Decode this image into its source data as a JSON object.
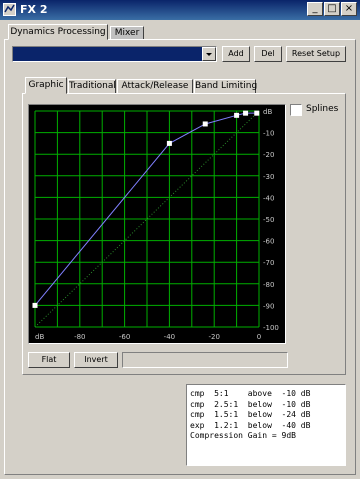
{
  "window": {
    "title": "FX 2",
    "btn_min": "_",
    "btn_max": "□",
    "btn_close": "×"
  },
  "main_tabs": [
    "Dynamics Processing",
    "Mixer"
  ],
  "toolbar": {
    "preset_value": "",
    "add": "Add",
    "del": "Del",
    "reset": "Reset Setup"
  },
  "sub_tabs": [
    "Graphic",
    "Traditional",
    "Attack/Release",
    "Band Limiting"
  ],
  "splines": {
    "label": "Splines",
    "checked": false
  },
  "graph": {
    "y_ticks": [
      "dB",
      "-10",
      "-20",
      "-30",
      "-40",
      "-50",
      "-60",
      "-70",
      "-80",
      "-90",
      "-100"
    ],
    "x_ticks": [
      "dB",
      "-80",
      "-60",
      "-40",
      "-20",
      "0"
    ],
    "colors": {
      "background": "#000000",
      "grid": "#00b000",
      "curve": "#8080ff",
      "points": "#ffffff"
    },
    "curve_points": [
      [
        -100,
        -90
      ],
      [
        -40,
        -15
      ],
      [
        -24,
        -6
      ],
      [
        -10,
        -2
      ],
      [
        -6,
        -1
      ],
      [
        -1,
        -1
      ]
    ]
  },
  "bottom": {
    "flat": "Flat",
    "invert": "Invert",
    "status": ""
  },
  "info": {
    "lines": [
      "cmp  5:1    above  -10 dB",
      "cmp  2.5:1  below  -10 dB",
      "cmp  1.5:1  below  -24 dB",
      "exp  1.2:1  below  -40 dB",
      "Compression Gain = 9dB"
    ]
  }
}
